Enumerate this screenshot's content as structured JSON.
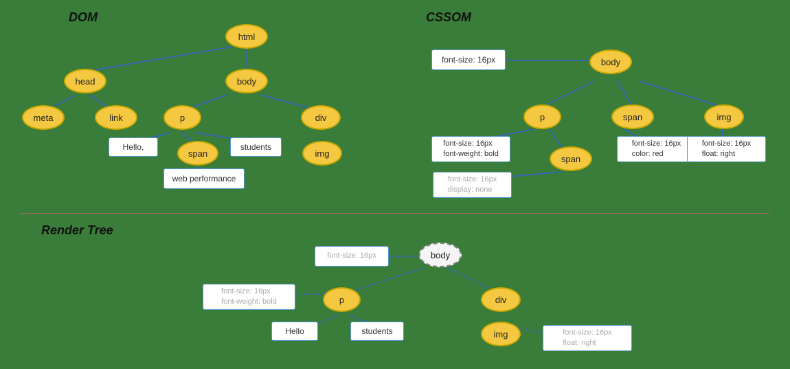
{
  "sections": {
    "dom_title": "DOM",
    "cssom_title": "CSSOM",
    "render_title": "Render Tree"
  },
  "dom": {
    "nodes": {
      "html": "html",
      "head": "head",
      "body": "body",
      "meta": "meta",
      "link": "link",
      "p": "p",
      "span": "span",
      "div": "div",
      "img": "img"
    },
    "rects": {
      "hello": "Hello,",
      "students": "students",
      "web_performance": "web performance"
    }
  },
  "cssom": {
    "nodes": {
      "body": "body",
      "p": "p",
      "span1": "span",
      "span2": "span",
      "img": "img"
    },
    "rects": {
      "r_body": "font-size: 16px",
      "r_p": "font-size: 16px\nfont-weight: bold",
      "r_span1": "font-size: 16px\ncolor: red",
      "r_span2": "font-size: 16px\ndisplay: none",
      "r_img": "font-size: 16px\nfloat: right"
    }
  },
  "render": {
    "nodes": {
      "body": "body",
      "p": "p",
      "div": "div",
      "img": "img"
    },
    "rects": {
      "r_body": "font-size: 16px",
      "r_p": "font-size: 16px\nfont-weight: bold",
      "r_img": "font-size: 16px\nfloat: right",
      "hello": "Hello",
      "students": "students"
    }
  }
}
